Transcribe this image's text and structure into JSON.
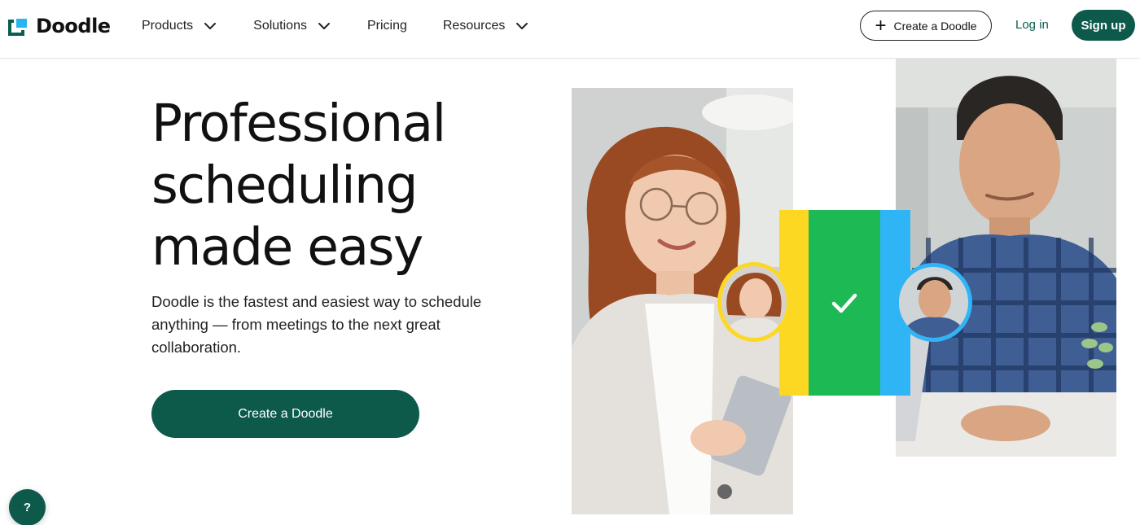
{
  "header": {
    "logo_text": "Doodle",
    "nav": [
      {
        "label": "Products",
        "has_dropdown": true
      },
      {
        "label": "Solutions",
        "has_dropdown": true
      },
      {
        "label": "Pricing",
        "has_dropdown": false
      },
      {
        "label": "Resources",
        "has_dropdown": true
      }
    ],
    "create_label": "Create a Doodle",
    "login_label": "Log in",
    "signup_label": "Sign up"
  },
  "hero": {
    "headline_lines": [
      "Professional",
      "scheduling",
      "made easy"
    ],
    "subtext": "Doodle is the fastest and easiest way to schedule anything — from meetings to the next great collaboration.",
    "cta_label": "Create a Doodle"
  },
  "help": {
    "label": "?"
  },
  "colors": {
    "brand_green": "#0d5a4b",
    "accent_yellow": "#fcd823",
    "accent_green": "#1db954",
    "accent_blue": "#2fb5f6"
  },
  "icons": {
    "logo": "doodle-logo-icon",
    "chevron": "chevron-down-icon",
    "plus": "plus-icon",
    "check": "check-icon"
  }
}
